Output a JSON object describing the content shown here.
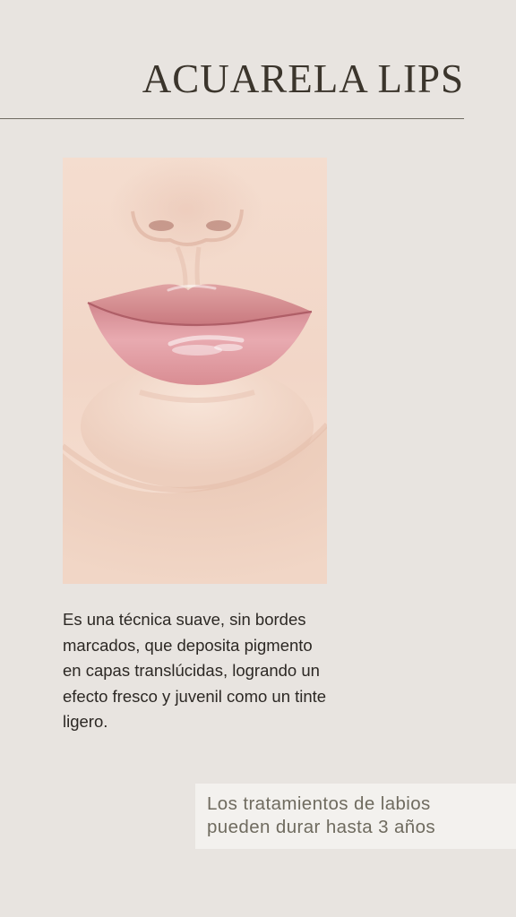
{
  "header": {
    "title": "ACUARELA LIPS"
  },
  "image": {
    "subject": "close-up of glossy pink lips with nose and chin"
  },
  "description": {
    "text": "Es una técnica suave, sin bordes marcados, que deposita pigmento en capas translúcidas, logrando un efecto fresco y juvenil como un tinte ligero."
  },
  "callout": {
    "line1": "Los tratamientos de labios",
    "line2": "pueden durar hasta 3 años"
  },
  "colors": {
    "background": "#e8e4e0",
    "title": "#3b352c",
    "body_text": "#2c2824",
    "callout_bg": "#f3f1ee",
    "callout_text": "#6f6b5f",
    "lip": "#d98d93"
  }
}
